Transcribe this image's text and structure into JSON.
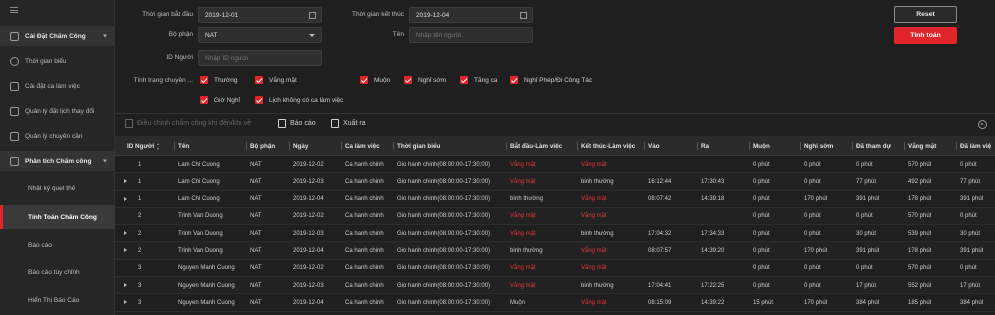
{
  "sidebar": {
    "groups": [
      {
        "label": "Cài Đặt Chấm Công",
        "icon": "settings-icon"
      },
      {
        "label": "Phân tích Chấm công",
        "icon": "analysis-icon"
      }
    ],
    "items": [
      {
        "label": "Thời gian biểu",
        "icon": "clock-icon"
      },
      {
        "label": "Cài đặt ca làm việc",
        "icon": "shift-icon"
      },
      {
        "label": "Quản lý đặt lịch thay đổi",
        "icon": "schedule-icon"
      },
      {
        "label": "Quản lý chuyên cần",
        "icon": "attendance-icon"
      }
    ],
    "subitems": [
      "Nhật ký quẹt thẻ",
      "Tính Toán Chấm Công",
      "Báo cáo",
      "Báo cáo tùy chỉnh",
      "Hiển Thị Báo Cáo"
    ]
  },
  "filters": {
    "start_label": "Thời gian bắt đầu",
    "start_value": "2019-12-01",
    "end_label": "Thời gian kết thúc",
    "end_value": "2019-12-04",
    "dept_label": "Bộ phận",
    "dept_value": "NAT",
    "name_label": "Tên",
    "name_placeholder": "Nhập tên người",
    "id_label": "ID Người",
    "id_placeholder": "Nhập ID người",
    "status_label": "Tình trạng chuyên ...",
    "checkboxes": [
      "Thường",
      "Vắng mặt",
      "Muộn",
      "Nghỉ sớm",
      "Tăng ca",
      "Nghỉ Phép/Đi Công Tác",
      "Giờ Nghỉ",
      "Lịch không có ca làm việc"
    ]
  },
  "buttons": {
    "reset": "Reset",
    "calculate": "Tính toán"
  },
  "toolbar": {
    "edit": "Điều chỉnh chấm công khi đến/khi về",
    "report": "Báo cáo",
    "export": "Xuất ra"
  },
  "table": {
    "headers": [
      "ID Người",
      "Tên",
      "Bộ phận",
      "Ngày",
      "Ca làm việc",
      "Thời gian biểu",
      "Bắt đầu-Làm việc",
      "Kết thúc-Làm việc",
      "Vào",
      "Ra",
      "Muộn",
      "Nghỉ sớm",
      "Đã tham dự",
      "Vắng mặt",
      "Đã làm việ"
    ],
    "rows": [
      [
        "1",
        "Lam Chi Cuong",
        "NAT",
        "2019-12-02",
        "Ca hanh chinh",
        "Gio hanh chinh(08:00:00-17:30:00)",
        "Vắng mặt",
        "Vắng mặt",
        "",
        "",
        "0 phút",
        "0 phút",
        "0 phút",
        "570 phút",
        "0 phút"
      ],
      [
        "1",
        "Lam Chi Cuong",
        "NAT",
        "2019-12-03",
        "Ca hanh chinh",
        "Gio hanh chinh(08:00:00-17:30:00)",
        "Vắng mặt",
        "binh thường",
        "16:12:44",
        "17:30:43",
        "0 phút",
        "0 phút",
        "77 phút",
        "492 phút",
        "77 phút"
      ],
      [
        "1",
        "Lam Chi Cuong",
        "NAT",
        "2019-12-04",
        "Ca hanh chinh",
        "Gio hanh chinh(08:00:00-17:30:00)",
        "bình thường",
        "Vắng mặt",
        "08:07:42",
        "14:39:18",
        "0 phút",
        "170 phút",
        "391 phút",
        "178 phút",
        "391 phút"
      ],
      [
        "2",
        "Trinh Van Duong",
        "NAT",
        "2019-12-02",
        "Ca hanh chinh",
        "Gio hanh chinh(08:00:00-17:30:00)",
        "Vắng mặt",
        "Vắng mặt",
        "",
        "",
        "0 phút",
        "0 phút",
        "0 phút",
        "570 phút",
        "0 phút"
      ],
      [
        "2",
        "Trinh Van Duong",
        "NAT",
        "2019-12-03",
        "Ca hanh chinh",
        "Gio hanh chinh(08:00:00-17:30:00)",
        "Vắng mặt",
        "binh thường",
        "17:04:32",
        "17:34:33",
        "0 phút",
        "0 phút",
        "30 phút",
        "539 phút",
        "30 phút"
      ],
      [
        "2",
        "Trinh Van Duong",
        "NAT",
        "2019-12-04",
        "Ca hanh chinh",
        "Gio hanh chinh(08:00:00-17:30:00)",
        "binh thường",
        "Vắng mặt",
        "08:07:57",
        "14:39:20",
        "0 phút",
        "170 phút",
        "391 phút",
        "178 phút",
        "391 phút"
      ],
      [
        "3",
        "Nguyen Manh Cuong",
        "NAT",
        "2019-12-02",
        "Ca hanh chinh",
        "Gio hanh chinh(08:00:00-17:30:00)",
        "Vắng mặt",
        "Vắng mặt",
        "",
        "",
        "0 phút",
        "0 phút",
        "0 phút",
        "570 phút",
        "0 phút"
      ],
      [
        "3",
        "Nguyen Manh Cuong",
        "NAT",
        "2019-12-03",
        "Ca hanh chinh",
        "Gio hanh chinh(08:00:00-17:30:00)",
        "Vắng mặt",
        "binh thường",
        "17:04:41",
        "17:22:25",
        "0 phút",
        "0 phút",
        "17 phút",
        "552 phút",
        "17 phút"
      ],
      [
        "3",
        "Nguyen Manh Cuong",
        "NAT",
        "2019-12-04",
        "Ca hanh chinh",
        "Gio hanh chinh(08:00:00-17:30:00)",
        "Muộn",
        "Vắng mặt",
        "08:15:09",
        "14:39:22",
        "15 phút",
        "170 phút",
        "384 phút",
        "185 phút",
        "384 phút"
      ]
    ],
    "expandable": [
      false,
      true,
      true,
      false,
      true,
      true,
      false,
      true,
      true
    ]
  },
  "colors": {
    "accent": "#e1252a",
    "danger_text": "#e53935"
  }
}
